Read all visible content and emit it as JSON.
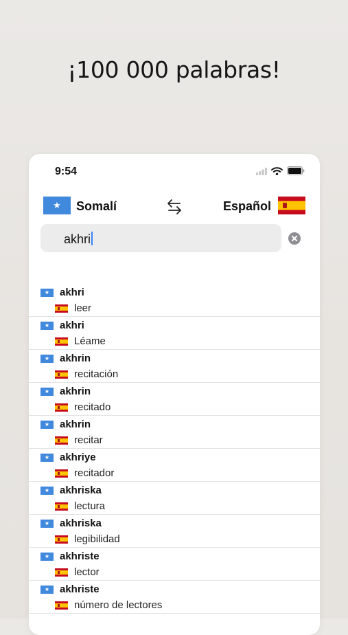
{
  "headline": "¡100 000 palabras!",
  "status_bar": {
    "time": "9:54"
  },
  "languages": {
    "source": "Somalí",
    "target": "Español",
    "source_flag": "somalia-flag-icon",
    "target_flag": "spain-flag-icon"
  },
  "search": {
    "value": "akhri"
  },
  "results": [
    {
      "word": "akhri",
      "translation": "leer"
    },
    {
      "word": "akhri",
      "translation": "Léame"
    },
    {
      "word": "akhrin",
      "translation": "recitación"
    },
    {
      "word": "akhrin",
      "translation": "recitado"
    },
    {
      "word": "akhrin",
      "translation": "recitar"
    },
    {
      "word": "akhriye",
      "translation": "recitador"
    },
    {
      "word": "akhriska",
      "translation": "lectura"
    },
    {
      "word": "akhriska",
      "translation": "legibilidad"
    },
    {
      "word": "akhriste",
      "translation": "lector"
    },
    {
      "word": "akhriste",
      "translation": "número de lectores"
    }
  ],
  "colors": {
    "somalia_blue": "#4189dd",
    "spain_red": "#c60b1e",
    "spain_yellow": "#ffc400",
    "caret": "#3a82f7"
  }
}
